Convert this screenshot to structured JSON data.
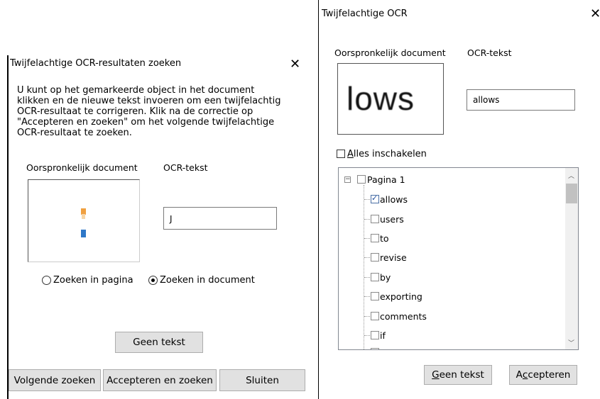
{
  "dialog1": {
    "title": "Twijfelachtige OCR-resultaten zoeken",
    "instructions": [
      "U kunt op het gemarkeerde object in het document",
      "klikken en de nieuwe tekst invoeren om een twijfelachtig",
      "OCR-resultaat te corrigeren. Klik na de correctie op",
      "\"Accepteren en zoeken\" om het volgende twijfelachtige",
      "OCR-resultaat te zoeken."
    ],
    "original_label": "Oorspronkelijk document",
    "ocr_label": "OCR-tekst",
    "ocr_value": "J",
    "radio_page": "Zoeken in pagina",
    "radio_document": "Zoeken in document",
    "radio_selected": "document",
    "no_text_button": "Geen tekst",
    "next_button": "Volgende zoeken",
    "accept_find_button": "Accepteren en zoeken",
    "close_button": "Sluiten"
  },
  "dialog2": {
    "title": "Twijfelachtige OCR",
    "original_label": "Oorspronkelijk document",
    "ocr_label": "OCR-tekst",
    "preview_text": "lows",
    "ocr_value": "allows",
    "enable_all_prefix": "A",
    "enable_all_rest": "lles inschakelen",
    "tree": {
      "root_label": "Pagina 1",
      "items": [
        {
          "label": "allows",
          "checked": true
        },
        {
          "label": "users",
          "checked": false
        },
        {
          "label": "to",
          "checked": false
        },
        {
          "label": "revise",
          "checked": false
        },
        {
          "label": "by",
          "checked": false
        },
        {
          "label": "exporting",
          "checked": false
        },
        {
          "label": "comments",
          "checked": false
        },
        {
          "label": "if",
          "checked": false
        }
      ]
    },
    "no_text_prefix": "G",
    "no_text_rest": "een tekst",
    "accept_prefix": "A",
    "accept_u": "c",
    "accept_rest": "cepteren"
  },
  "icons": {
    "close": "close-icon",
    "scroll_up": "chevron-up-icon",
    "scroll_down": "chevron-down-icon",
    "tree_collapse": "minus-box-icon"
  },
  "colors": {
    "button_bg": "#e1e1e1",
    "button_border": "#adadad",
    "check_accent": "#1f4e9e",
    "thumb_orange": "#f0a040",
    "thumb_blue": "#2f78c8"
  }
}
